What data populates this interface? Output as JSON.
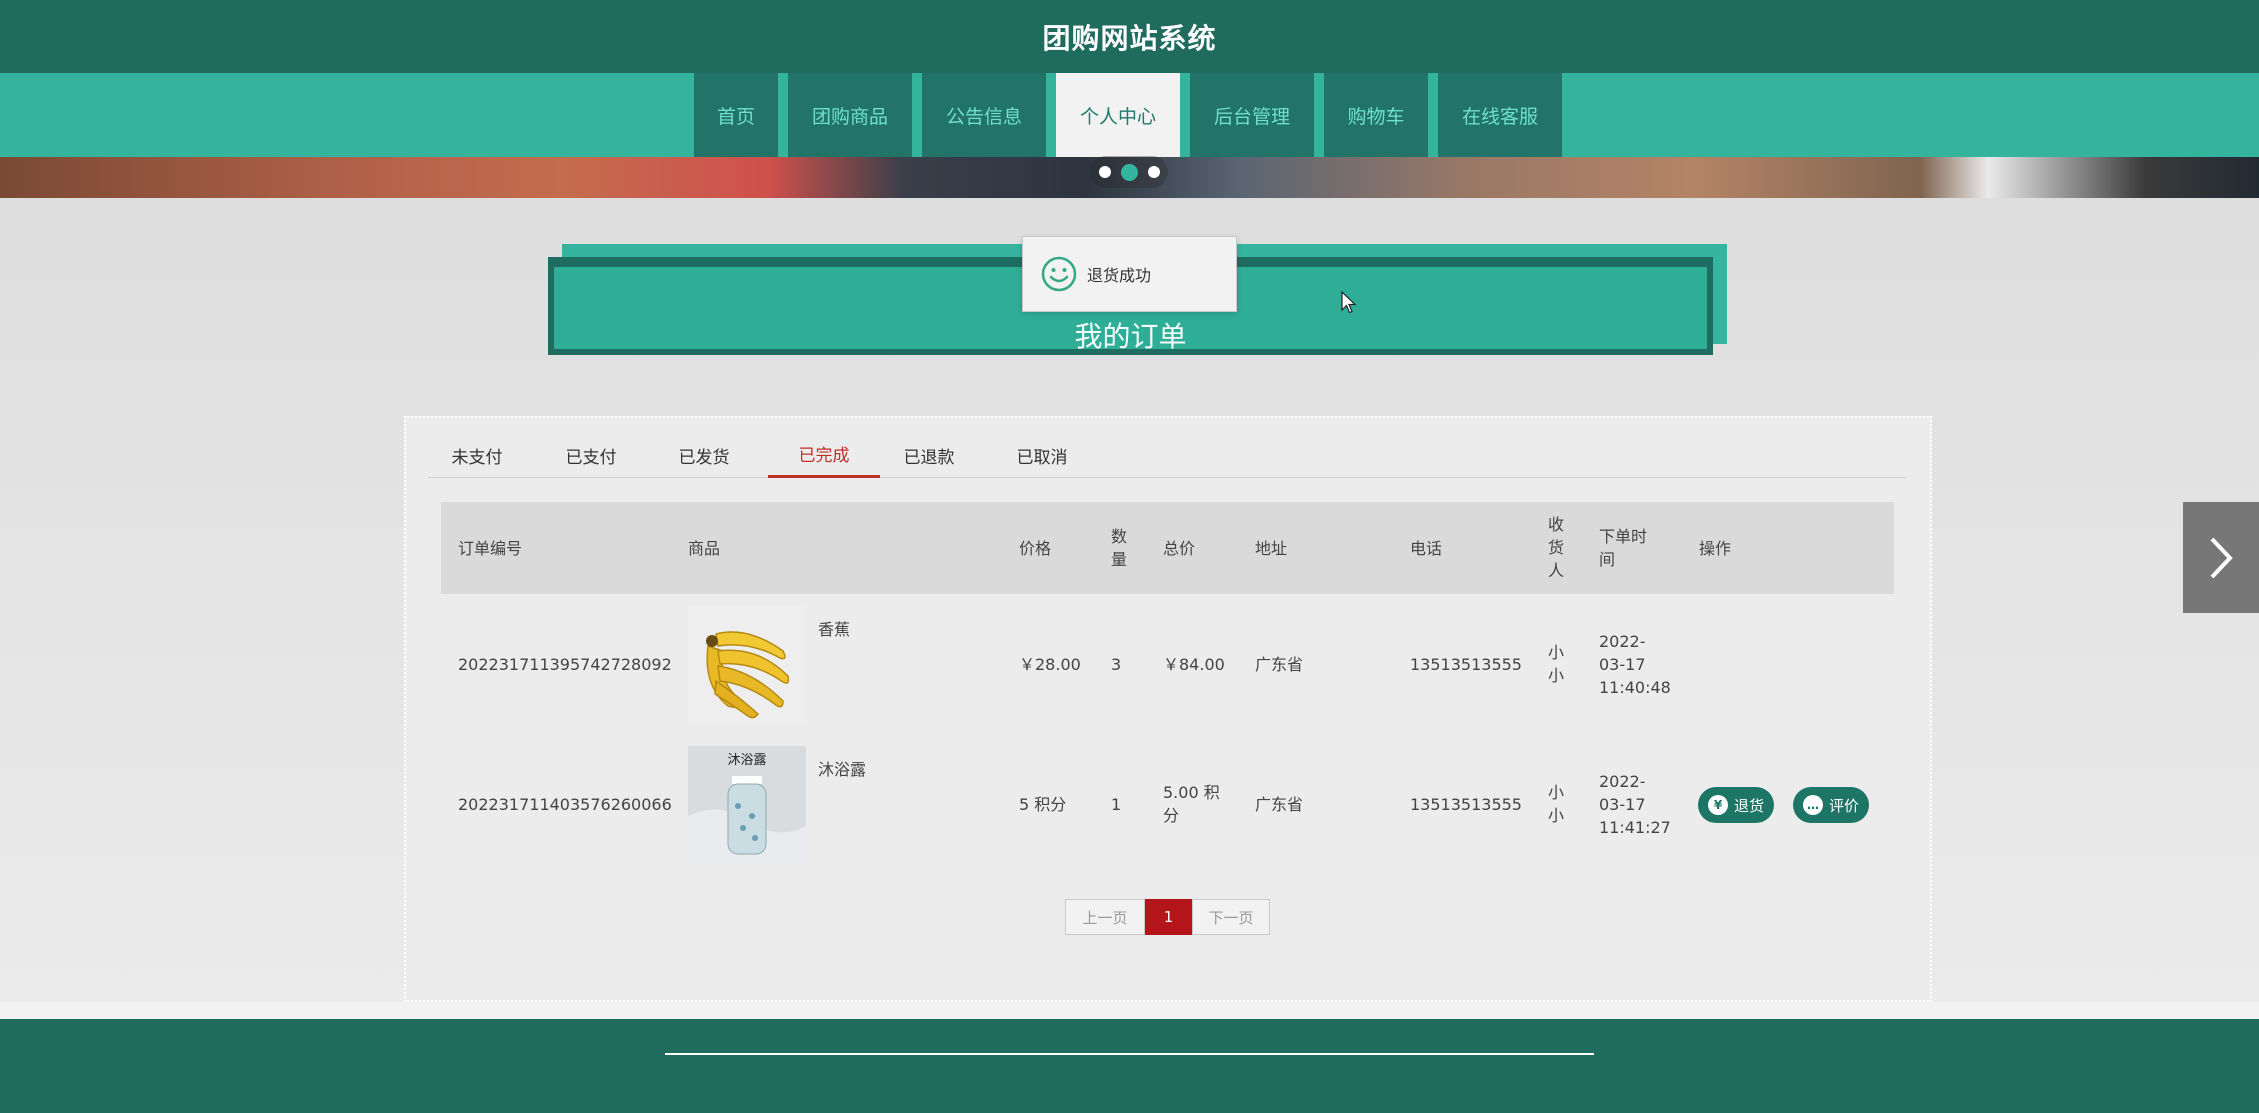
{
  "site": {
    "title": "团购网站系统"
  },
  "nav": {
    "items": [
      {
        "label": "首页"
      },
      {
        "label": "团购商品"
      },
      {
        "label": "公告信息"
      },
      {
        "label": "个人中心"
      },
      {
        "label": "后台管理"
      },
      {
        "label": "购物车"
      },
      {
        "label": "在线客服"
      }
    ],
    "active_index": 3
  },
  "carousel": {
    "dot_count": 3,
    "active_index": 1
  },
  "page_title": "我的订单",
  "toast": {
    "message": "退货成功",
    "icon": "smile-icon"
  },
  "tabs": [
    {
      "label": "未支付"
    },
    {
      "label": "已支付"
    },
    {
      "label": "已发货"
    },
    {
      "label": "已完成"
    },
    {
      "label": "已退款"
    },
    {
      "label": "已取消"
    }
  ],
  "active_tab": "已完成",
  "table": {
    "headers": {
      "order_no": "订单编号",
      "product": "商品",
      "price": "价格",
      "qty_1": "数",
      "qty_2": "量",
      "total": "总价",
      "address": "地址",
      "phone": "电话",
      "receiver_1": "收",
      "receiver_2": "货",
      "receiver_3": "人",
      "time_1": "下单时",
      "time_2": "间",
      "action": "操作"
    },
    "rows": [
      {
        "order_no": "20223171139574272 8092",
        "order_no_full": "202231711395742728092",
        "product_name": "香蕉",
        "product_image": "banana-image",
        "price": "￥28.00",
        "qty": "3",
        "total": "￥84.00",
        "address": "广东省",
        "phone": "13513513555",
        "receiver_1": "小",
        "receiver_2": "小",
        "date": "2022-",
        "date_2": "03-17",
        "time": "11:40:48"
      },
      {
        "order_no_full": "202231711403576260066",
        "product_name": "沐浴露",
        "product_image": "shower-gel-image",
        "price": "5 积分",
        "qty": "1",
        "total_1": "5.00 积",
        "total_2": "分",
        "address": "广东省",
        "phone": "13513513555",
        "receiver_1": "小",
        "receiver_2": "小",
        "date": "2022-",
        "date_2": "03-17",
        "time": "11:41:27",
        "actions": [
          {
            "label": "退货",
            "icon": "yen-icon"
          },
          {
            "label": "评价",
            "icon": "comment-icon"
          }
        ]
      }
    ]
  },
  "pagination": {
    "prev": "上一页",
    "current": "1",
    "next": "下一页"
  },
  "colors": {
    "header": "#1f6b5e",
    "nav": "#34b49c",
    "accent": "#c0302a",
    "button": "#1d7566"
  }
}
